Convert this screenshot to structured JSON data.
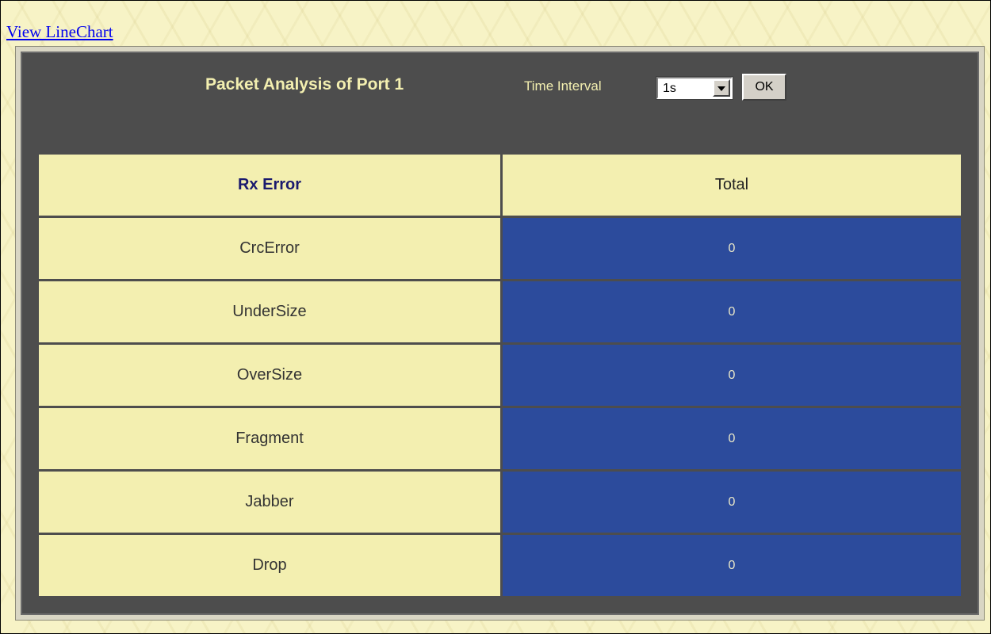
{
  "link": {
    "view_linechart": "View LineChart"
  },
  "panel": {
    "title": "Packet Analysis of Port 1",
    "time_interval_label": "Time Interval",
    "time_interval_value": "1s",
    "ok_label": "OK"
  },
  "table": {
    "header": {
      "name": "Rx Error",
      "total": "Total"
    },
    "rows": [
      {
        "name": "CrcError",
        "total": "0"
      },
      {
        "name": "UnderSize",
        "total": "0"
      },
      {
        "name": "OverSize",
        "total": "0"
      },
      {
        "name": "Fragment",
        "total": "0"
      },
      {
        "name": "Jabber",
        "total": "0"
      },
      {
        "name": "Drop",
        "total": "0"
      }
    ]
  },
  "colors": {
    "page_background": "#f7f3c6",
    "panel_background": "#4d4d4d",
    "cell_light": "#f3efb0",
    "cell_blue": "#2c4b9c"
  },
  "icons": {
    "select_arrow": "chevron-down-icon"
  }
}
